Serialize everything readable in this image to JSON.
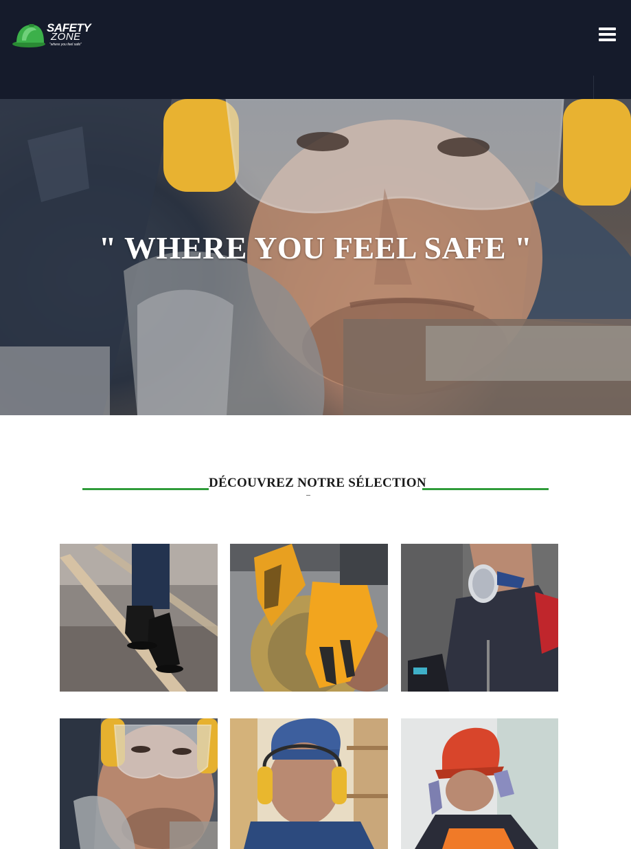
{
  "header": {
    "logo": {
      "line1": "SAFETY",
      "line2": "ZONE",
      "tagline": "\"where you feel safe\"",
      "accent_color": "#2f9c3a"
    },
    "menu_icon": "hamburger-menu-icon",
    "background": "#151b2b"
  },
  "hero": {
    "title": "\" WHERE YOU FEEL SAFE \""
  },
  "section": {
    "title": "DÉCOUVREZ NOTRE SÉLECTION",
    "line_color": "#2f9c3a"
  },
  "products": [
    {
      "name": "safety-shoes"
    },
    {
      "name": "work-gloves"
    },
    {
      "name": "respirator-mask"
    },
    {
      "name": "safety-goggles-earmuffs"
    },
    {
      "name": "ear-protection"
    },
    {
      "name": "hard-hat"
    }
  ]
}
